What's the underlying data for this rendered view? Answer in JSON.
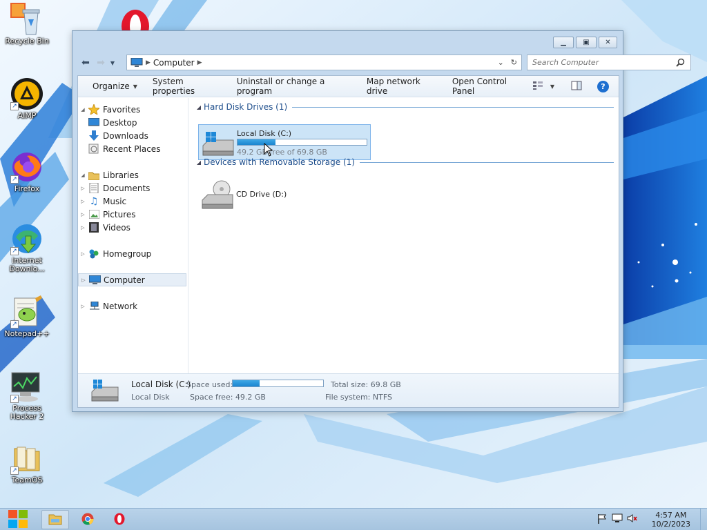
{
  "desktop": {
    "icons": [
      {
        "label": "Recycle Bin",
        "icon": "recycle-bin-icon"
      },
      {
        "label": "AIMP",
        "icon": "aimp-icon"
      },
      {
        "label": "Firefox",
        "icon": "firefox-icon"
      },
      {
        "label": "Internet Downlo...",
        "icon": "internet-download-manager-icon"
      },
      {
        "label": "Notepad++",
        "icon": "notepad-plus-plus-icon"
      },
      {
        "label": "Process Hacker 2",
        "icon": "process-hacker-icon"
      },
      {
        "label": "TeamOS",
        "icon": "folder-icon"
      }
    ]
  },
  "window": {
    "caption_buttons": [
      "minimize",
      "maximize",
      "close"
    ],
    "address": {
      "crumb": "Computer"
    },
    "search": {
      "placeholder": "Search Computer"
    },
    "toolbar": {
      "organize": "Organize",
      "system_properties": "System properties",
      "uninstall": "Uninstall or change a program",
      "map_drive": "Map network drive",
      "control_panel": "Open Control Panel"
    },
    "nav": {
      "favorites": "Favorites",
      "desktop": "Desktop",
      "downloads": "Downloads",
      "recent": "Recent Places",
      "libraries": "Libraries",
      "documents": "Documents",
      "music": "Music",
      "pictures": "Pictures",
      "videos": "Videos",
      "homegroup": "Homegroup",
      "computer": "Computer",
      "network": "Network"
    },
    "groups": {
      "hdd": "Hard Disk Drives (1)",
      "removable": "Devices with Removable Storage (1)"
    },
    "drive_c": {
      "name": "Local Disk (C:)",
      "free_text": "49.2 GB free of 69.8 GB",
      "used_fraction": 0.295
    },
    "drive_d": {
      "name": "CD Drive (D:)"
    },
    "details": {
      "name": "Local Disk (C:)",
      "type": "Local Disk",
      "space_used_label": "Space used:",
      "space_free": "Space free: 49.2 GB",
      "total_size": "Total size: 69.8 GB",
      "file_system": "File system: NTFS",
      "used_fraction": 0.295
    }
  },
  "taskbar": {
    "apps": [
      "file-explorer-icon",
      "chrome-icon",
      "opera-icon"
    ],
    "clock": {
      "time": "4:57 AM",
      "date": "10/2/2023"
    }
  },
  "colors": {
    "accent": "#1b85cf",
    "selection": "#cce4f7",
    "group_title": "#1e4e8c"
  }
}
